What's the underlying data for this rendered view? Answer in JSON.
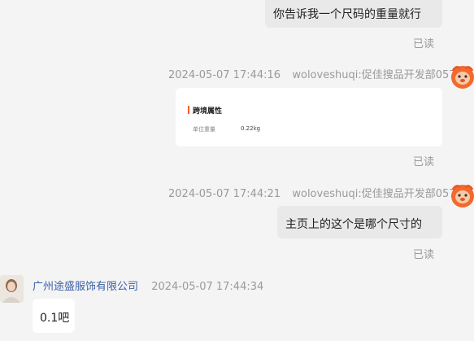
{
  "messages": {
    "m1": {
      "text": "你告诉我一个尺码的重量就行",
      "status": "已读"
    },
    "m2": {
      "timestamp": "2024-05-07 17:44:16",
      "sender": "woloveshuqi:促佳搜品开发部057",
      "card": {
        "title": "跨境属性",
        "key": "单位重量",
        "value": "0.22kg"
      },
      "status": "已读"
    },
    "m3": {
      "timestamp": "2024-05-07 17:44:21",
      "sender": "woloveshuqi:促佳搜品开发部057",
      "text": "主页上的这个是哪个尺寸的",
      "status": "已读"
    },
    "m4": {
      "sender": "广州途盛服饰有限公司",
      "timestamp": "2024-05-07 17:44:34",
      "text": "0.1吧"
    }
  },
  "colors": {
    "accent": "#ff5a1f",
    "bubble_self": "#e9e9e9",
    "bubble_other": "#ffffff",
    "sender_link": "#3a5fa8"
  },
  "icons": {
    "self_avatar": "cartoon-lion-icon",
    "other_avatar": "person-photo-icon"
  }
}
